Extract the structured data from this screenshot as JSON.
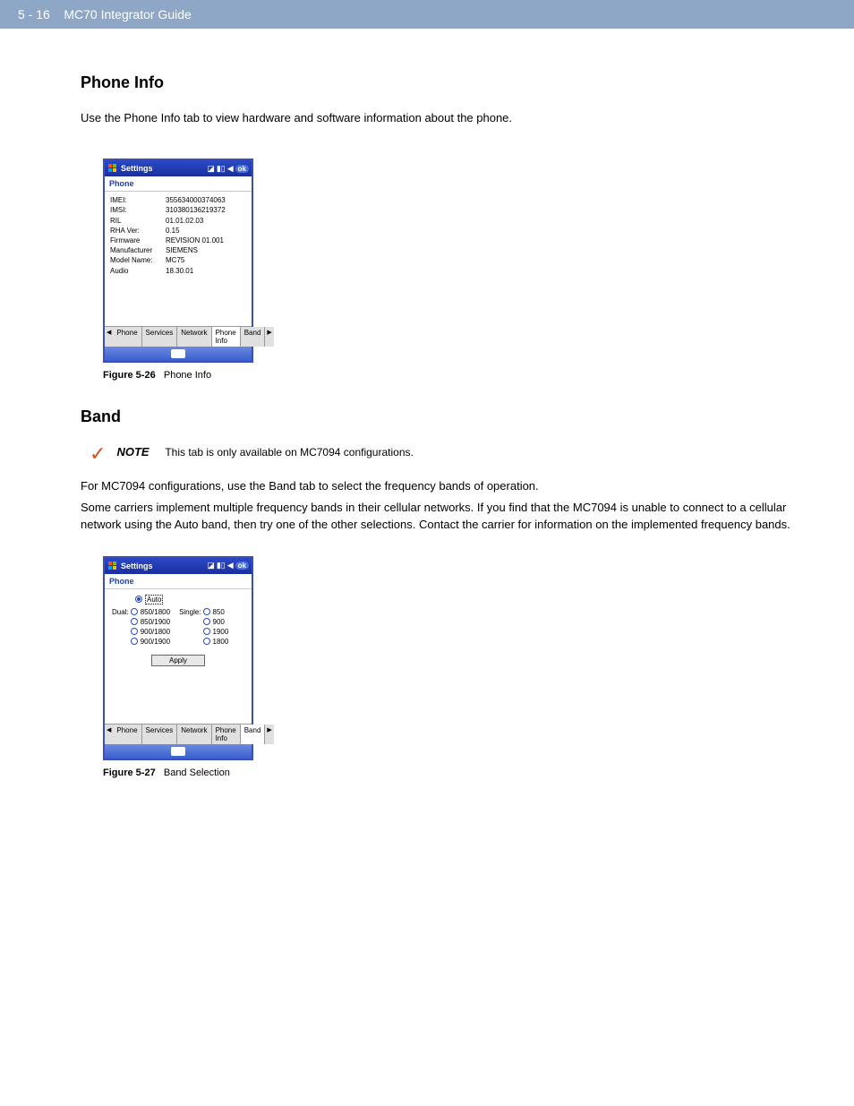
{
  "header": {
    "page_num": "5 - 16",
    "doc_title": "MC70 Integrator Guide"
  },
  "section1": {
    "heading": "Phone Info",
    "para": "Use the Phone Info tab to view hardware and software information about the phone."
  },
  "pda1": {
    "title": "Settings",
    "subtitle": "Phone",
    "rows": [
      {
        "label": "IMEI:",
        "value": "355634000374063"
      },
      {
        "label": "IMSI:",
        "value": "310380136219372"
      },
      {
        "label": "RIL",
        "value": "01.01.02.03"
      },
      {
        "label": "RHA Ver:",
        "value": "0.15"
      },
      {
        "label": "Firmware",
        "value": "REVISION 01.001"
      },
      {
        "label": "Manufacturer",
        "value": "SIEMENS"
      },
      {
        "label": "Model Name:",
        "value": "MC75"
      },
      {
        "label": "Audio",
        "value": "18.30.01"
      }
    ],
    "tabs": [
      "Phone",
      "Services",
      "Network",
      "Phone Info",
      "Band"
    ],
    "active_tab": 3,
    "ok": "ok"
  },
  "fig1": {
    "label": "Figure 5-26",
    "caption": "Phone Info"
  },
  "section2": {
    "heading": "Band",
    "note_label": "NOTE",
    "note_text": "This tab is only available on MC7094 configurations.",
    "para1": "For MC7094 configurations, use the Band tab to select the frequency bands of operation.",
    "para2": "Some carriers implement multiple frequency bands in their cellular networks. If you find that the MC7094 is unable to connect to a cellular network using the Auto band, then try one of the other selections. Contact the carrier for information on the implemented frequency bands."
  },
  "pda2": {
    "title": "Settings",
    "subtitle": "Phone",
    "auto_label": "Auto",
    "dual_label": "Dual:",
    "single_label": "Single:",
    "dual_options": [
      "850/1800",
      "850/1900",
      "900/1800",
      "900/1900"
    ],
    "single_options": [
      "850",
      "900",
      "1900",
      "1800"
    ],
    "apply": "Apply",
    "tabs": [
      "Phone",
      "Services",
      "Network",
      "Phone Info",
      "Band"
    ],
    "active_tab": 4,
    "ok": "ok"
  },
  "fig2": {
    "label": "Figure 5-27",
    "caption": "Band Selection"
  }
}
